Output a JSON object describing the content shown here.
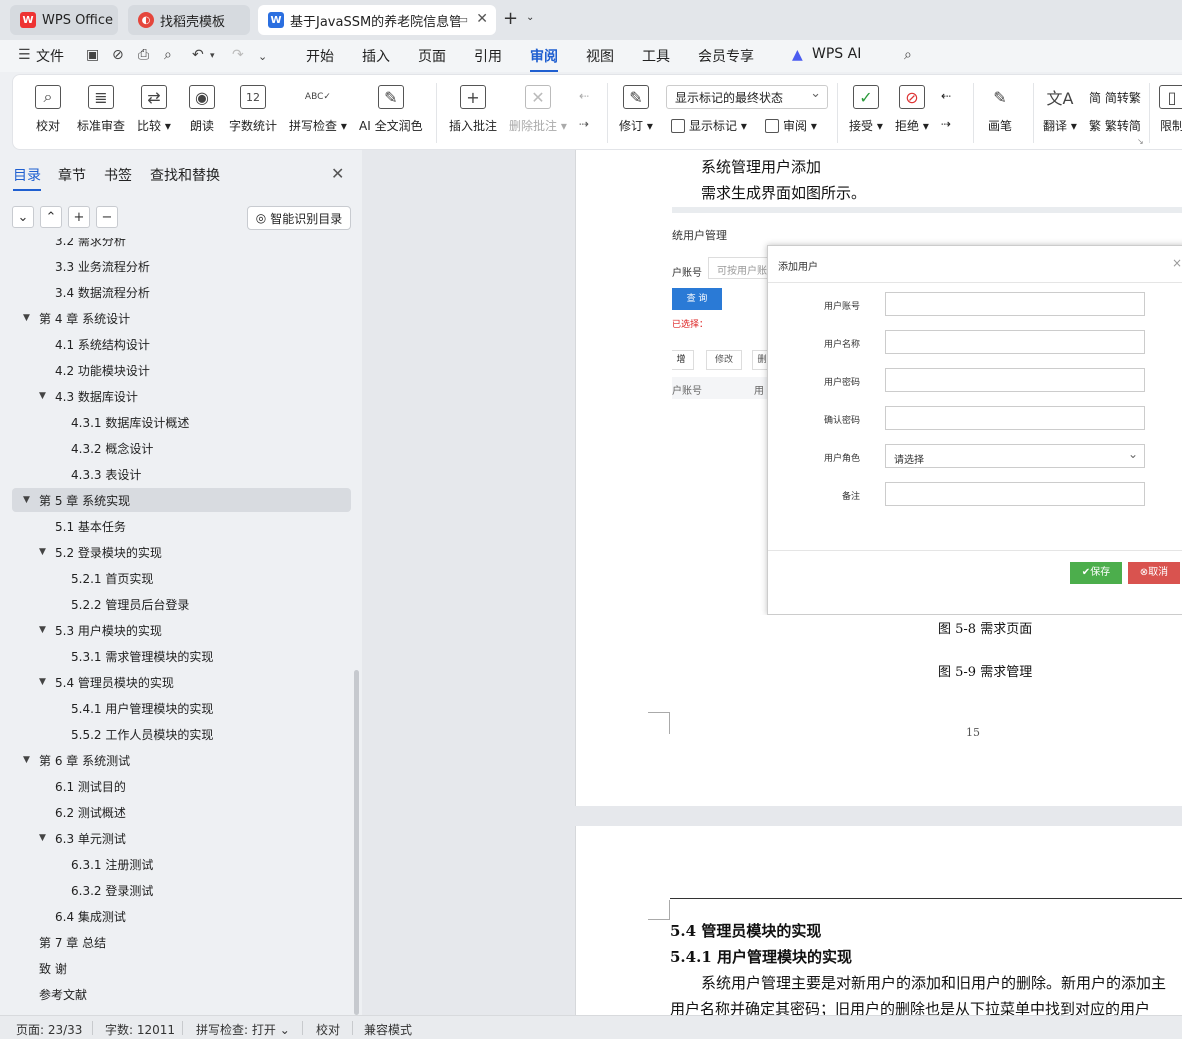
{
  "tabs": [
    {
      "label": "WPS Office",
      "icon": "wps-logo-icon"
    },
    {
      "label": "找稻壳模板",
      "icon": "docer-icon"
    },
    {
      "label": "基于JavaSSM的养老院信息管",
      "icon": "word-doc-icon"
    }
  ],
  "menu": {
    "file": "文件",
    "items": [
      "开始",
      "插入",
      "页面",
      "引用",
      "审阅",
      "视图",
      "工具",
      "会员专享",
      "WPS AI"
    ],
    "active": "审阅"
  },
  "ribbon": {
    "proofread": "校对",
    "standard_review": "标准审查",
    "compare": "比较",
    "read_aloud": "朗读",
    "word_count": "字数统计",
    "spell_check": "拼写检查",
    "ai_polish": "AI 全文润色",
    "insert_comment": "插入批注",
    "delete_comment": "删除批注",
    "markup_select": "显示标记的最终状态",
    "track_changes": "修订",
    "show_markup": "显示标记",
    "review": "审阅",
    "accept": "接受",
    "reject": "拒绝",
    "pen": "画笔",
    "translate": "翻译",
    "to_traditional": "简转繁",
    "to_simplified": "繁转简",
    "restrict": "限制"
  },
  "sidebar": {
    "tabs": [
      "目录",
      "章节",
      "书签",
      "查找和替换"
    ],
    "ai_toc": "智能识别目录",
    "toc": [
      {
        "level": 2,
        "text": "3.2 需求分析",
        "arrow": false
      },
      {
        "level": 2,
        "text": "3.3 业务流程分析",
        "arrow": false
      },
      {
        "level": 2,
        "text": "3.4 数据流程分析",
        "arrow": false
      },
      {
        "level": 1,
        "text": "第 4 章  系统设计",
        "arrow": true
      },
      {
        "level": 2,
        "text": "4.1 系统结构设计",
        "arrow": false
      },
      {
        "level": 2,
        "text": "4.2 功能模块设计",
        "arrow": false
      },
      {
        "level": 2,
        "text": "4.3 数据库设计",
        "arrow": true
      },
      {
        "level": 3,
        "text": "4.3.1 数据库设计概述",
        "arrow": false
      },
      {
        "level": 3,
        "text": "4.3.2 概念设计",
        "arrow": false
      },
      {
        "level": 3,
        "text": "4.3.3 表设计",
        "arrow": false
      },
      {
        "level": 1,
        "text": "第 5 章   系统实现",
        "arrow": true,
        "selected": true
      },
      {
        "level": 2,
        "text": "5.1 基本任务",
        "arrow": false
      },
      {
        "level": 2,
        "text": "5.2 登录模块的实现",
        "arrow": true
      },
      {
        "level": 3,
        "text": "5.2.1 首页实现",
        "arrow": false
      },
      {
        "level": 3,
        "text": "5.2.2 管理员后台登录",
        "arrow": false
      },
      {
        "level": 2,
        "text": "5.3 用户模块的实现",
        "arrow": true
      },
      {
        "level": 3,
        "text": "5.3.1 需求管理模块的实现",
        "arrow": false
      },
      {
        "level": 2,
        "text": "5.4 管理员模块的实现",
        "arrow": true
      },
      {
        "level": 3,
        "text": "5.4.1 用户管理模块的实现",
        "arrow": false
      },
      {
        "level": 3,
        "text": "5.5.2 工作人员模块的实现",
        "arrow": false
      },
      {
        "level": 1,
        "text": "第 6 章   系统测试",
        "arrow": true
      },
      {
        "level": 2,
        "text": "6.1 测试目的",
        "arrow": false
      },
      {
        "level": 2,
        "text": "6.2 测试概述",
        "arrow": false
      },
      {
        "level": 2,
        "text": "6.3 单元测试",
        "arrow": true
      },
      {
        "level": 3,
        "text": "6.3.1 注册测试",
        "arrow": false
      },
      {
        "level": 3,
        "text": "6.3.2 登录测试",
        "arrow": false
      },
      {
        "level": 2,
        "text": "6.4 集成测试",
        "arrow": false
      },
      {
        "level": 1,
        "text": "第 7 章   总结",
        "arrow": false
      },
      {
        "level": 1,
        "text": "致   谢",
        "arrow": false
      },
      {
        "level": 1,
        "text": "参考文献",
        "arrow": false
      }
    ]
  },
  "document": {
    "line1": "系统管理用户添加",
    "line2": "需求生成界面如图所示。",
    "caption1": "图 5-8 需求页面",
    "caption2": "图 5-9 需求管理",
    "page_number": "15",
    "heading1": "5.4 管理员模块的实现",
    "heading2": "5.4.1 用户管理模块的实现",
    "para1": "系统用户管理主要是对新用户的添加和旧用户的删除。新用户的添加主",
    "para2": "用户名称并确定其密码；旧用户的删除也是从下拉菜单中找到对应的用户"
  },
  "screenshot": {
    "bg_title": "统用户管理",
    "bg_account": "户账号",
    "bg_placeholder": "可按用户账",
    "bg_query": "查 询",
    "bg_selected": "已选择：",
    "bg_add": "增",
    "bg_edit": "修改",
    "bg_del": "删",
    "bg_col1": "户账号",
    "bg_col2": "用",
    "modal_title": "添加用户",
    "modal_close": "×",
    "fields": [
      "用户账号",
      "用户名称",
      "用户密码",
      "确认密码",
      "用户角色",
      "备注"
    ],
    "role_placeholder": "请选择",
    "save": "保存",
    "cancel": "取消"
  },
  "status": {
    "page": "页面: 23/33",
    "words": "字数: 12011",
    "spell": "拼写检查: 打开",
    "proof": "校对",
    "mode": "兼容模式"
  }
}
